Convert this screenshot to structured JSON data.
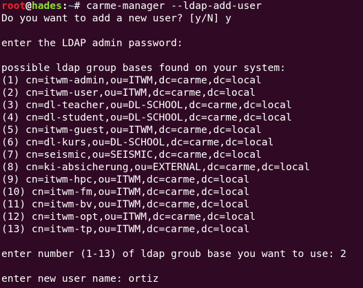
{
  "prompt": {
    "user": "root",
    "at": "@",
    "host": "hades",
    "colon": ":",
    "path": "~",
    "sign": "#",
    "command": " carme-manager --ldap-add-user"
  },
  "output": {
    "add_user_question": "Do you want to add a new user? [y/N] y",
    "admin_password_prompt": "enter the LDAP admin password:",
    "group_bases_header": "possible ldap group bases found on your system:",
    "group_bases": [
      "(1) cn=itwm-admin,ou=ITWM,dc=carme,dc=local",
      "(2) cn=itwm-user,ou=ITWM,dc=carme,dc=local",
      "(3) cn=dl-teacher,ou=DL-SCHOOL,dc=carme,dc=local",
      "(4) cn=dl-student,ou=DL-SCHOOL,dc=carme,dc=local",
      "(5) cn=itwm-guest,ou=ITWM,dc=carme,dc=local",
      "(6) cn=dl-kurs,ou=DL-SCHOOL,dc=carme,dc=local",
      "(7) cn=seismic,ou=SEISMIC,dc=carme,dc=local",
      "(8) cn=ki-absicherung,ou=EXTERNAL,dc=carme,dc=local",
      "(9) cn=itwm-hpc,ou=ITWM,dc=carme,dc=local",
      "(10) cn=itwm-fm,ou=ITWM,dc=carme,dc=local",
      "(11) cn=itwm-bv,ou=ITWM,dc=carme,dc=local",
      "(12) cn=itwm-opt,ou=ITWM,dc=carme,dc=local",
      "(13) cn=itwm-tp,ou=ITWM,dc=carme,dc=local"
    ],
    "group_number_prompt": "enter number (1-13) of ldap groub base you want to use: 2",
    "user_name_prompt": "enter new user name: ortiz"
  },
  "colors": {
    "background": "#300a24",
    "text": "#ffffff",
    "prompt_user": "#ef2929",
    "prompt_host": "#8ae234",
    "prompt_path": "#729fcf"
  }
}
